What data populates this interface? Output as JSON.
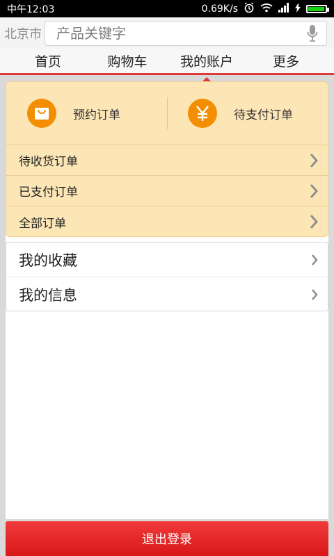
{
  "status_bar": {
    "time": "中午12:03",
    "speed": "0.69K/s",
    "icons": [
      "alarm-icon",
      "wifi-icon",
      "signal-icon",
      "charging-icon",
      "battery-icon"
    ],
    "battery_level": 0.95
  },
  "search": {
    "city": "北京市",
    "placeholder": "产品关键字",
    "value": ""
  },
  "tabs": {
    "items": [
      {
        "label": "首页"
      },
      {
        "label": "购物车"
      },
      {
        "label": "我的账户"
      },
      {
        "label": "更多"
      }
    ],
    "active": 2
  },
  "orders": {
    "quick": [
      {
        "label": "预约订单",
        "icon": "shopping-bag-icon"
      },
      {
        "label": "待支付订单",
        "icon": "yen-icon"
      }
    ],
    "items": [
      {
        "label": "待收货订单"
      },
      {
        "label": "已支付订单"
      },
      {
        "label": "全部订单"
      }
    ]
  },
  "my": {
    "items": [
      {
        "label": "我的收藏"
      },
      {
        "label": "我的信息"
      }
    ]
  },
  "logout": {
    "label": "退出登录"
  },
  "colors": {
    "accent": "#dd3a3a",
    "orders_bg": "#fce6b6",
    "icon_orange": "#f28e00",
    "battery_green": "#19d10f"
  }
}
